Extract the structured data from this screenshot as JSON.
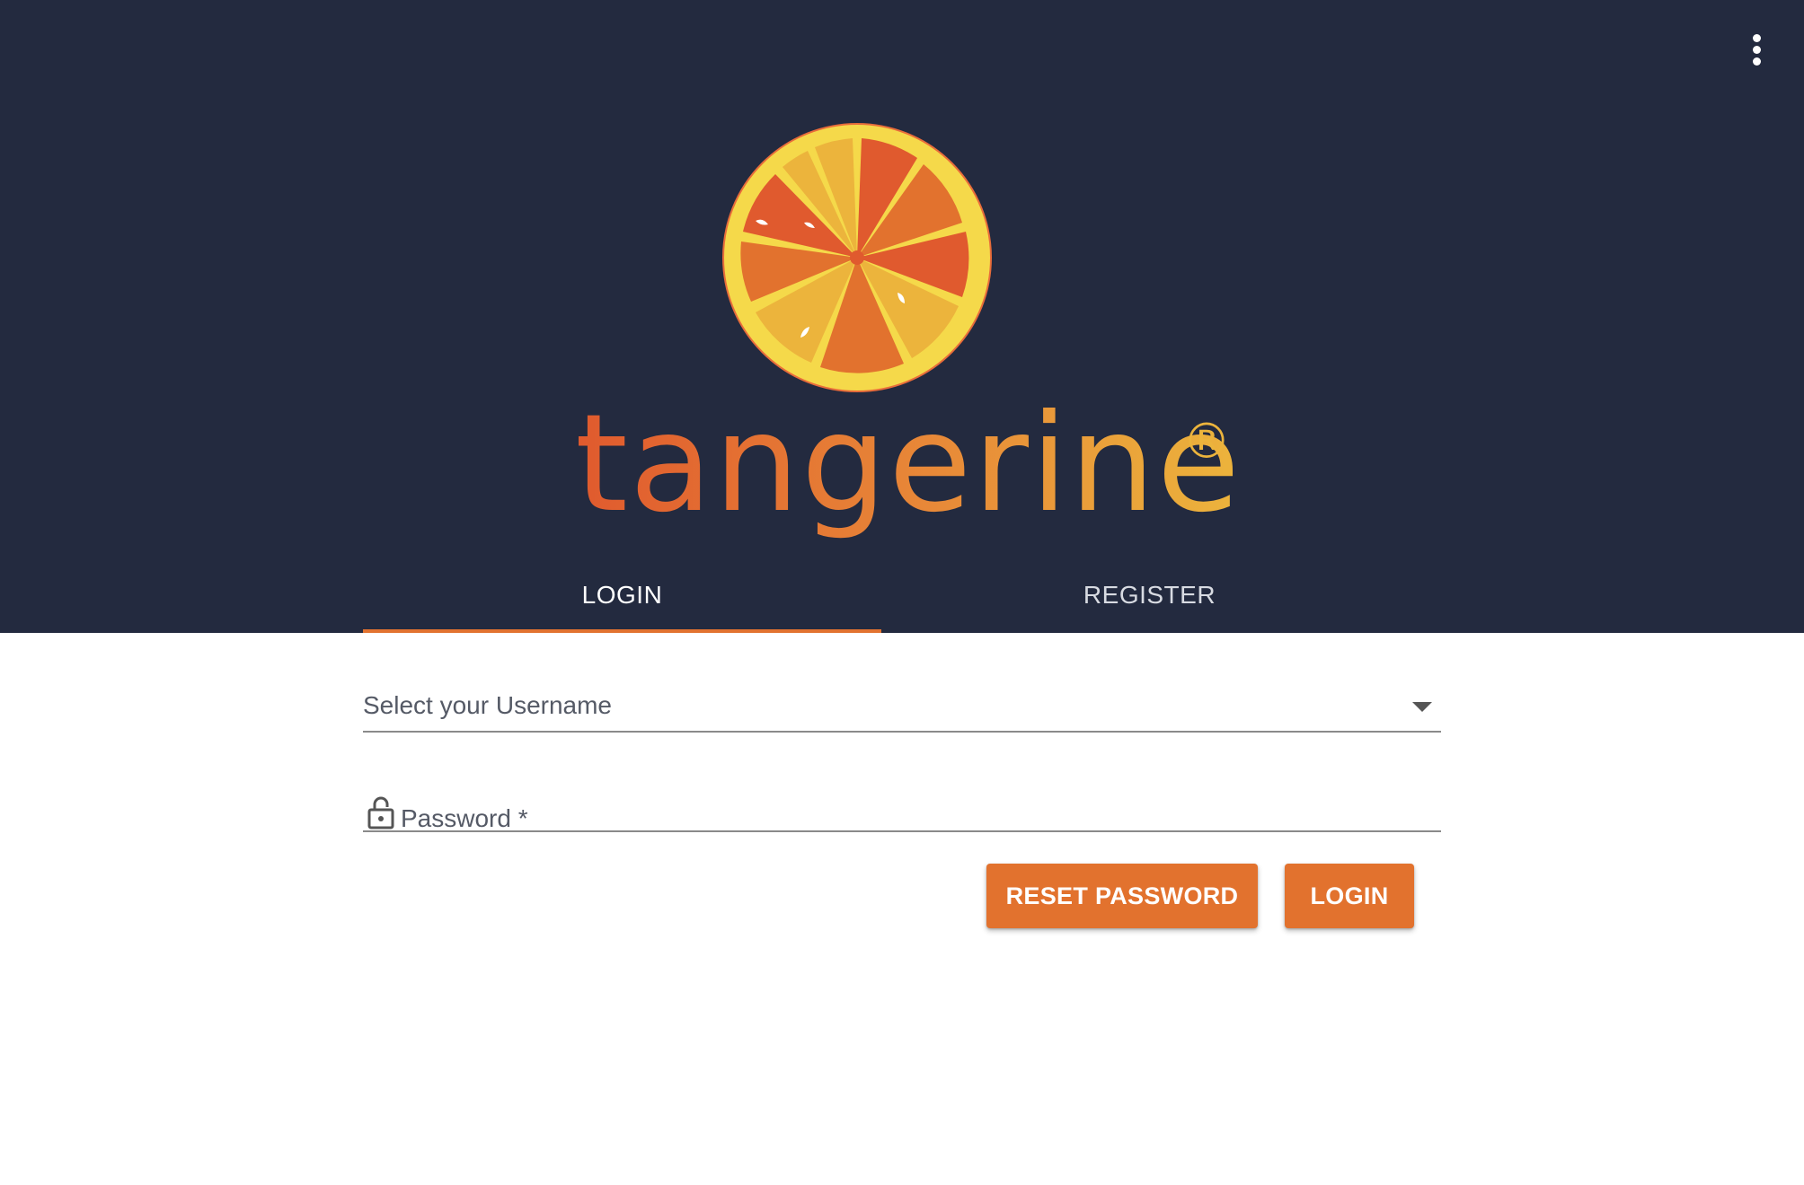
{
  "app": {
    "brand_name": "tangerine",
    "brand_mark": "®"
  },
  "header": {
    "menu_icon": "more-vert-icon"
  },
  "tabs": [
    {
      "label": "LOGIN",
      "active": true
    },
    {
      "label": "REGISTER",
      "active": false
    }
  ],
  "form": {
    "username_label": "Select your Username",
    "password_label": "Password *",
    "lock_icon": "lock-open-icon",
    "reset_button": "RESET PASSWORD",
    "login_button": "LOGIN"
  },
  "colors": {
    "header_bg": "#232a3f",
    "accent": "#e2722e",
    "brand_orange_dark": "#e05a2e",
    "brand_yellow": "#ecb43c"
  }
}
